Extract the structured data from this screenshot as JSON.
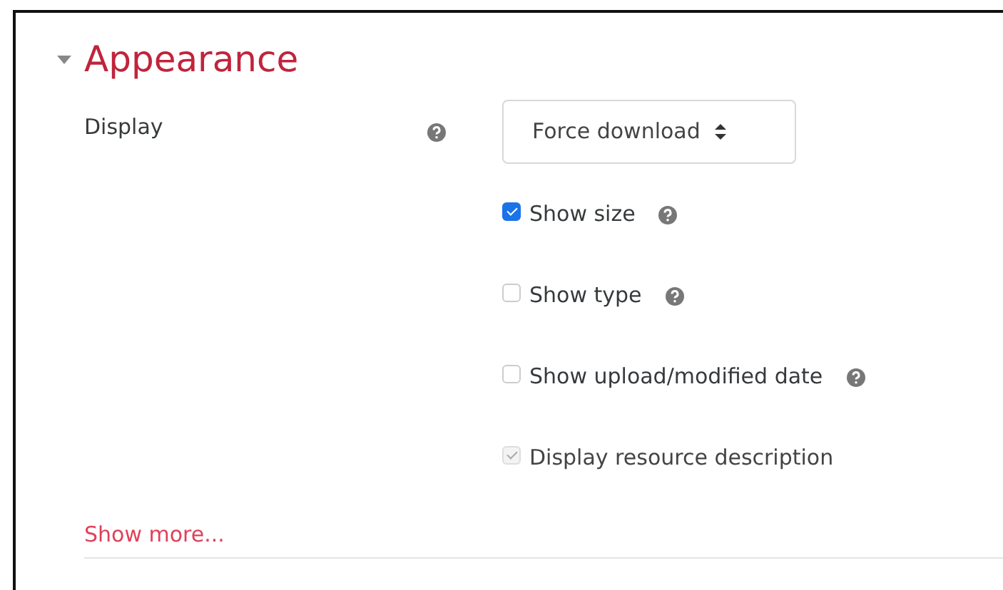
{
  "section": {
    "title": "Appearance",
    "expanded": true
  },
  "fields": [
    {
      "label": "Display",
      "value": "Force download"
    }
  ],
  "options": [
    {
      "label": "Show size",
      "checked": true,
      "disabled": false,
      "help": true
    },
    {
      "label": "Show type",
      "checked": false,
      "disabled": false,
      "help": true
    },
    {
      "label": "Show upload/modified date",
      "checked": false,
      "disabled": false,
      "help": true
    },
    {
      "label": "Display resource description",
      "checked": true,
      "disabled": true,
      "help": false
    }
  ],
  "show_more": "Show more..."
}
